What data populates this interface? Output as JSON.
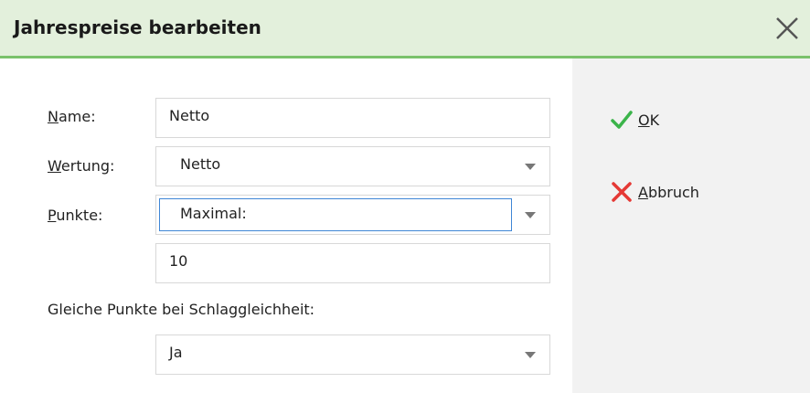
{
  "dialog": {
    "title": "Jahrespreise bearbeiten"
  },
  "form": {
    "name": {
      "label_key": "N",
      "label_rest": "ame:",
      "value": "Netto"
    },
    "wertung": {
      "label_key": "W",
      "label_rest": "ertung:",
      "value": "Netto"
    },
    "punkte": {
      "label_key": "P",
      "label_rest": "unkte:",
      "value": "Maximal:"
    },
    "punkte_value": "10",
    "gleiche_punkte": {
      "label": "Gleiche Punkte bei Schlaggleichheit:",
      "value": "Ja"
    }
  },
  "actions": {
    "ok": {
      "key": "O",
      "rest": "K",
      "icon": "checkmark-icon",
      "color": "#3bb44a"
    },
    "abbruch": {
      "key": "A",
      "rest": "bbruch",
      "icon": "cross-icon",
      "color": "#e53935"
    }
  },
  "colors": {
    "title_bg": "#e3f0dc",
    "title_line": "#7ac26b",
    "side_panel": "#f2f2f2",
    "focus_border": "#3f86d6"
  }
}
